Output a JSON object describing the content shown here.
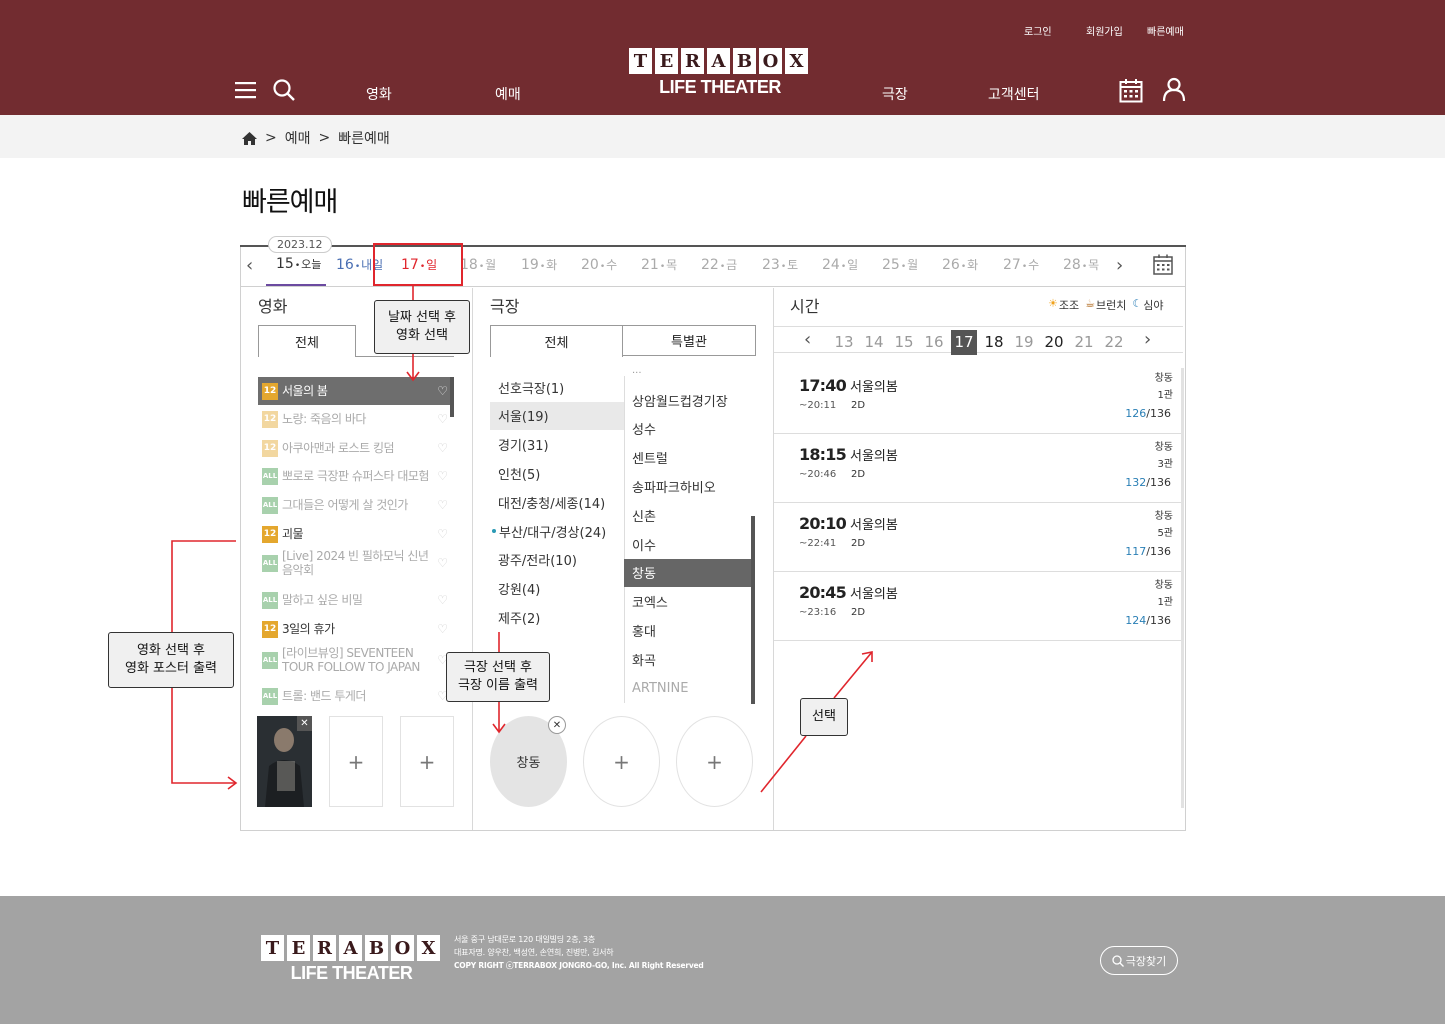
{
  "header": {
    "top_links": [
      "로그인",
      "회원가입",
      "빠른예매"
    ],
    "nav_left": [
      "영화",
      "예매"
    ],
    "nav_right": [
      "극장",
      "고객센터"
    ],
    "logo_letters": [
      "T",
      "E",
      "R",
      "A",
      "B",
      "O",
      "X"
    ],
    "logo_sub": "LIFE THEATER",
    "icons": [
      "menu-icon",
      "search-icon",
      "calendar-icon",
      "user-icon"
    ],
    "bg_color": "#722c30"
  },
  "breadcrumb": {
    "home_icon": "home-icon",
    "sep": ">",
    "items": [
      "예매",
      "빠른예매"
    ]
  },
  "page_title": "빠른예매",
  "date_bar": {
    "year_month": "2023.12",
    "dates": [
      {
        "num": "15",
        "dot": "•",
        "day": "오늘"
      },
      {
        "num": "16",
        "dot": "•",
        "day": "내일"
      },
      {
        "num": "17",
        "dot": "•",
        "day": "일"
      },
      {
        "num": "18",
        "dot": "•",
        "day": "월"
      },
      {
        "num": "19",
        "dot": "•",
        "day": "화"
      },
      {
        "num": "20",
        "dot": "•",
        "day": "수"
      },
      {
        "num": "21",
        "dot": "•",
        "day": "목"
      },
      {
        "num": "22",
        "dot": "•",
        "day": "금"
      },
      {
        "num": "23",
        "dot": "•",
        "day": "토"
      },
      {
        "num": "24",
        "dot": "•",
        "day": "일"
      },
      {
        "num": "25",
        "dot": "•",
        "day": "월"
      },
      {
        "num": "26",
        "dot": "•",
        "day": "화"
      },
      {
        "num": "27",
        "dot": "•",
        "day": "수"
      },
      {
        "num": "28",
        "dot": "•",
        "day": "목"
      }
    ],
    "selected_index": 2
  },
  "movie_section": {
    "title": "영화",
    "tab_all": "전체",
    "movies": [
      {
        "rating": "12",
        "title": "서울의 봄",
        "selected": true
      },
      {
        "rating": "12",
        "title": "노량: 죽음의 바다"
      },
      {
        "rating": "12",
        "title": "아쿠아맨과 로스트 킹덤"
      },
      {
        "rating": "ALL",
        "title": "뽀로로 극장판 슈퍼스타 대모험"
      },
      {
        "rating": "ALL",
        "title": "그대들은 어떻게 살 것인가"
      },
      {
        "rating": "12",
        "title": "괴물",
        "available": true
      },
      {
        "rating": "ALL",
        "title": "[Live] 2024 빈 필하모닉 신년 음악회"
      },
      {
        "rating": "ALL",
        "title": "말하고 싶은 비밀"
      },
      {
        "rating": "12",
        "title": "3일의 휴가",
        "available": true
      },
      {
        "rating": "ALL",
        "title": "[라이브뷰잉] SEVENTEEN TOUR FOLLOW TO JAPAN"
      },
      {
        "rating": "ALL",
        "title": "트롤: 밴드 투게더"
      }
    ],
    "heart_glyph": "♡",
    "slot_plus": "+",
    "slot_close": "✕"
  },
  "theater_section": {
    "title": "극장",
    "tab_all": "전체",
    "tab_special": "특별관",
    "regions": [
      "선호극장(1)",
      "서울(19)",
      "경기(31)",
      "인천(5)",
      "대전/충청/세종(14)",
      "부산/대구/경상(24)",
      "광주/전라(10)",
      "강원(4)",
      "제주(2)"
    ],
    "region_selected": 1,
    "region_dot_index": 5,
    "theaters": [
      "상암월드컵경기장",
      "성수",
      "센트럴",
      "송파파크하비오",
      "신촌",
      "이수",
      "창동",
      "코엑스",
      "홍대",
      "화곡",
      "ARTNINE"
    ],
    "theater_selected": 6,
    "selected_theater_name": "창동",
    "slot_plus": "+",
    "slot_close": "✕"
  },
  "time_section": {
    "title": "시간",
    "legend": [
      {
        "icon": "sun-icon",
        "label": "조조"
      },
      {
        "icon": "coffee-icon",
        "label": "브런치"
      },
      {
        "icon": "moon-icon",
        "label": "심야"
      }
    ],
    "hours": [
      "13",
      "14",
      "15",
      "16",
      "17",
      "18",
      "19",
      "20",
      "21",
      "22"
    ],
    "hour_selected": 4,
    "hour_available": [
      4,
      5,
      7
    ],
    "showtimes": [
      {
        "start": "17:40",
        "end": "~20:11",
        "movie": "서울의봄",
        "format": "2D",
        "branch": "창동",
        "screen": "1관",
        "remain": "126",
        "total": "136"
      },
      {
        "start": "18:15",
        "end": "~20:46",
        "movie": "서울의봄",
        "format": "2D",
        "branch": "창동",
        "screen": "3관",
        "remain": "132",
        "total": "136"
      },
      {
        "start": "20:10",
        "end": "~22:41",
        "movie": "서울의봄",
        "format": "2D",
        "branch": "창동",
        "screen": "5관",
        "remain": "117",
        "total": "136"
      },
      {
        "start": "20:45",
        "end": "~23:16",
        "movie": "서울의봄",
        "format": "2D",
        "branch": "창동",
        "screen": "1관",
        "remain": "124",
        "total": "136"
      }
    ]
  },
  "annotations": {
    "date_note": "날짜 선택 후\n영화 선택",
    "movie_note": "영화 선택 후\n영화 포스터 출력",
    "theater_note": "극장 선택 후\n극장 이름 출력",
    "select_note": "선택",
    "arrow_color": "#e0262d"
  },
  "footer": {
    "address": "서울 중구 남대문로 120 대일빌딩 2층, 3층",
    "ceo": "대표자명. 양우찬, 백성연, 손연희, 진병만, 김서하",
    "copyright": "COPY RIGHT ⓒTERRABOX JONGRO-GO, Inc. All Right Reserved",
    "find_theater": "극장찾기",
    "bg_color": "#a3a3a3"
  }
}
